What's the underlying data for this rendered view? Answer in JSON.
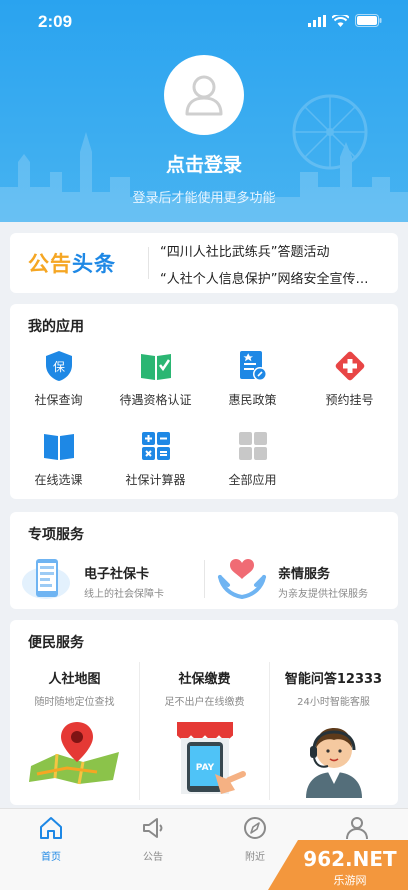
{
  "status": {
    "time": "2:09"
  },
  "header": {
    "login_title": "点击登录",
    "login_subtitle": "登录后才能使用更多功能"
  },
  "notice": {
    "logo_part1": "公告",
    "logo_part2": "头条",
    "items": [
      "“四川人社比武练兵”答题活动",
      "“人社个人信息保护”网络安全宣传…"
    ]
  },
  "my_apps": {
    "title": "我的应用",
    "items": [
      {
        "label": "社保查询",
        "icon": "shield-icon"
      },
      {
        "label": "待遇资格认证",
        "icon": "book-check-icon"
      },
      {
        "label": "惠民政策",
        "icon": "policy-doc-icon"
      },
      {
        "label": "预约挂号",
        "icon": "medical-cross-icon"
      },
      {
        "label": "在线选课",
        "icon": "open-book-icon"
      },
      {
        "label": "社保计算器",
        "icon": "calculator-icon"
      },
      {
        "label": "全部应用",
        "icon": "grid-icon"
      }
    ]
  },
  "special": {
    "title": "专项服务",
    "items": [
      {
        "name": "电子社保卡",
        "desc": "线上的社会保障卡"
      },
      {
        "name": "亲情服务",
        "desc": "为亲友提供社保服务"
      }
    ]
  },
  "convenience": {
    "title": "便民服务",
    "items": [
      {
        "name": "人社地图",
        "desc": "随时随地定位查找"
      },
      {
        "name": "社保缴费",
        "desc": "足不出户在线缴费"
      },
      {
        "name": "智能问答12333",
        "desc": "24小时智能客服"
      }
    ],
    "pay_sign": "PAY"
  },
  "tabs": [
    {
      "label": "首页",
      "icon": "home-icon",
      "active": true
    },
    {
      "label": "公告",
      "icon": "megaphone-icon",
      "active": false
    },
    {
      "label": "附近",
      "icon": "compass-icon",
      "active": false
    },
    {
      "label": "",
      "icon": "user-icon",
      "active": false
    }
  ],
  "watermark": {
    "brand": "962.NET",
    "sub": "乐游网"
  },
  "colors": {
    "primary": "#1e88e5",
    "header": "#2aa3ef",
    "accent_orange": "#f5a623",
    "red": "#e84545"
  }
}
